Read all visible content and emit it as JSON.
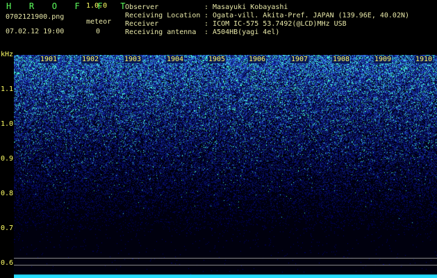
{
  "app": {
    "name": "H R O F F T",
    "version": "1.0.0"
  },
  "file": {
    "name": "0702121900.png",
    "datetime": "07.02.12 19:00"
  },
  "meteor": {
    "label": "meteor",
    "count": "0"
  },
  "station": [
    {
      "key": "Observer",
      "value": "Masayuki Kobayashi"
    },
    {
      "key": "Receiving Location",
      "value": "Ogata-vill. Akita-Pref. JAPAN (139.96E, 40.02N)"
    },
    {
      "key": "Receiver",
      "value": "ICOM IC-575 53.7492(@LCD)MHz USB"
    },
    {
      "key": "Receiving antenna",
      "value": "A504HB(yagi 4el)"
    }
  ],
  "axis": {
    "unit": "kHz",
    "freq_labels": [
      "1.1",
      "1.0",
      "0.9",
      "0.8",
      "0.7",
      "0.6"
    ],
    "time_labels": [
      "1901",
      "1902",
      "1903",
      "1904",
      "1905",
      "1906",
      "1907",
      "1908",
      "1909",
      "1910"
    ]
  },
  "colors": {
    "noise_low": "#000018",
    "noise_mid": "#1a3cc8",
    "noise_high": "#40ffe0",
    "text": "#ffff66",
    "brand": "#5dff5d"
  }
}
